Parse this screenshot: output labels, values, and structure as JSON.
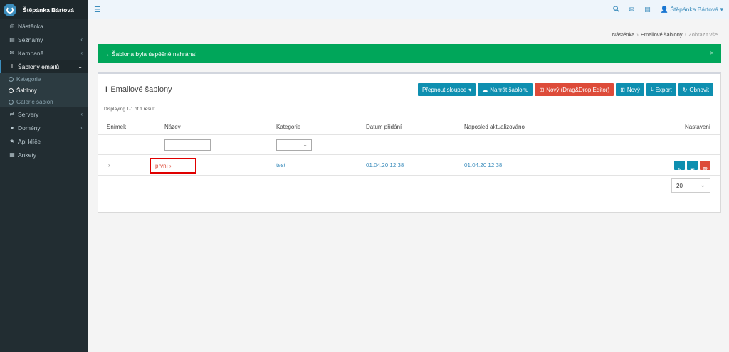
{
  "app": {
    "user_name": "Štěpánka Bártová"
  },
  "sidebar": {
    "items": [
      {
        "label": "Nástěnka",
        "icon": "dashboard-icon"
      },
      {
        "label": "Seznamy",
        "icon": "list-icon"
      },
      {
        "label": "Kampaně",
        "icon": "envelope-icon"
      },
      {
        "label": "Šablony emailů",
        "icon": "text-icon"
      },
      {
        "label": "Servery",
        "icon": "exchange-icon"
      },
      {
        "label": "Domény",
        "icon": "globe-icon"
      },
      {
        "label": "Api klíče",
        "icon": "star-icon"
      },
      {
        "label": "Ankety",
        "icon": "list-alt-icon"
      }
    ],
    "subitems": [
      {
        "label": "Kategorie"
      },
      {
        "label": "Šablony"
      },
      {
        "label": "Galerie šablon"
      }
    ]
  },
  "topbar": {
    "user_label": "Štěpánka Bártová"
  },
  "breadcrumb": {
    "home": "Nástěnka",
    "section": "Emailové šablony",
    "current": "Zobrazit vše"
  },
  "alert": {
    "text": "→ Šablona byla úspěšně nahrána!"
  },
  "box": {
    "title": "Emailové šablony",
    "buttons": {
      "toggle_columns": "Přepnout sloupce",
      "upload": "Nahrát šablonu",
      "new_dd": "Nový (Drag&Drop Editor)",
      "new": "Nový",
      "export": "Export",
      "refresh": "Obnovit"
    },
    "summary": "Displaying 1-1 of 1 result."
  },
  "table": {
    "headers": [
      "Snímek",
      "Název",
      "Kategorie",
      "Datum přidání",
      "Naposled aktualizováno",
      "Nastavení"
    ],
    "rows": [
      {
        "expand": "›",
        "name": "první ›",
        "category": "test",
        "created": "01.04.20 12:38",
        "updated": "01.04.20 12:38"
      }
    ],
    "page_size": "20"
  },
  "colors": {
    "accent": "#3c8dbc",
    "success": "#00a65a",
    "danger": "#dd4b39",
    "button_blue": "#0e8fb0",
    "sidebar_bg": "#222d32"
  }
}
